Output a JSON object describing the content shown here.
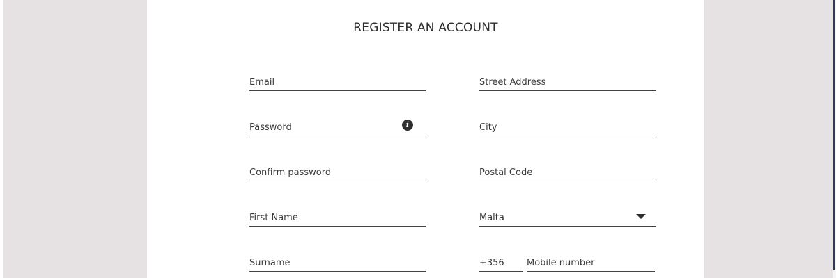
{
  "title": "REGISTER AN ACCOUNT",
  "fields": {
    "email": {
      "placeholder": "Email",
      "value": ""
    },
    "password": {
      "placeholder": "Password",
      "value": ""
    },
    "confirm_password": {
      "placeholder": "Confirm password",
      "value": ""
    },
    "first_name": {
      "placeholder": "First Name",
      "value": ""
    },
    "surname": {
      "placeholder": "Surname",
      "value": ""
    },
    "street_address": {
      "placeholder": "Street Address",
      "value": ""
    },
    "city": {
      "placeholder": "City",
      "value": ""
    },
    "postal_code": {
      "placeholder": "Postal Code",
      "value": ""
    },
    "country": {
      "selected": "Malta"
    },
    "phone_prefix": "+356",
    "mobile": {
      "placeholder": "Mobile number",
      "value": ""
    }
  },
  "icons": {
    "password_info": "info-icon",
    "country_dropdown": "chevron-down-icon"
  },
  "info_glyph": "i",
  "colors": {
    "page_background": "#e6e2e3",
    "card_background": "#ffffff",
    "text": "#2c2c2c",
    "accent_bar": "#2c3a5a"
  }
}
